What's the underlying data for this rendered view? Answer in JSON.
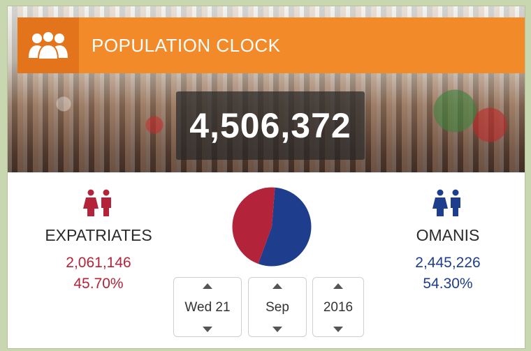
{
  "header": {
    "title": "POPULATION CLOCK",
    "icon": "people-group-icon"
  },
  "total_population": "4,506,372",
  "expatriates": {
    "label": "EXPATRIATES",
    "count": "2,061,146",
    "percent": "45.70%",
    "color": "#b3233a",
    "icon": "people-pair-icon"
  },
  "omanis": {
    "label": "OMANIS",
    "count": "2,445,226",
    "percent": "54.30%",
    "color": "#1e3d8c",
    "icon": "people-pair-icon"
  },
  "pie_share": {
    "expatriates_fraction": 0.457,
    "omanis_fraction": 0.543
  },
  "date_picker": {
    "day": "Wed 21",
    "month": "Sep",
    "year": "2016"
  },
  "colors": {
    "header": "#f28a2a",
    "header_icon_box": "#e3741b"
  }
}
